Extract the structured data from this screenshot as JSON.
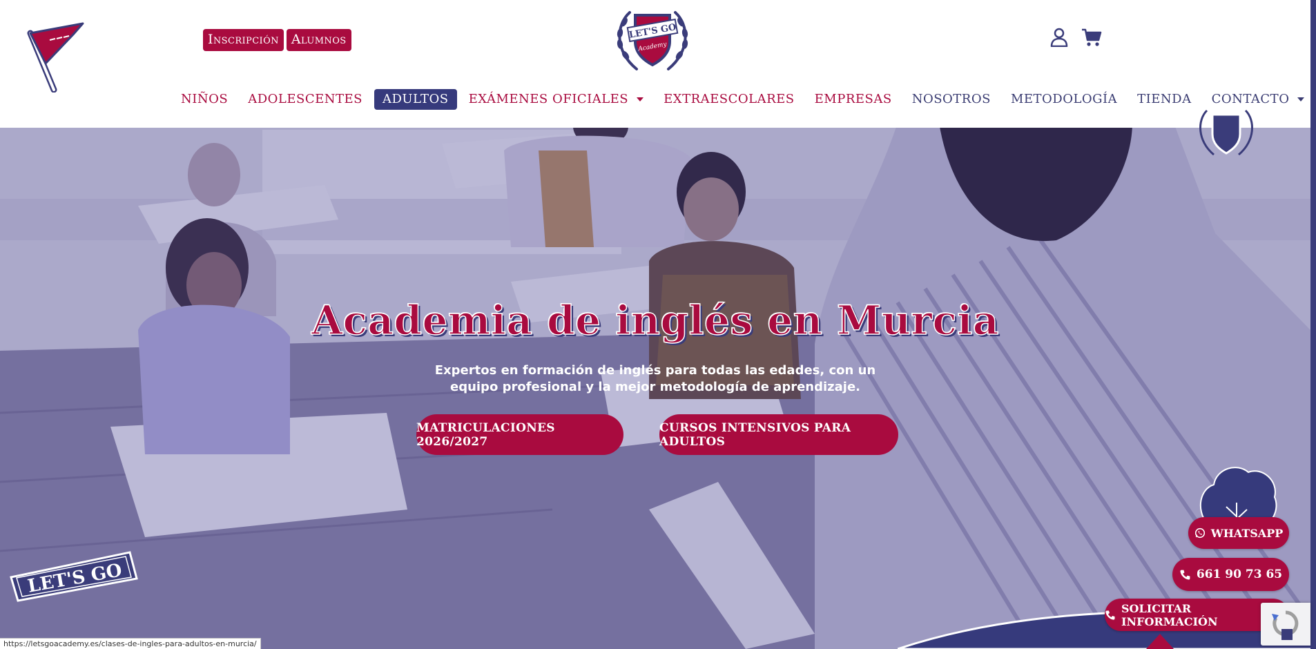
{
  "top_links": [
    {
      "label": "Inscripción"
    },
    {
      "label": "Alumnos"
    }
  ],
  "brand": {
    "line1": "LET'S GO",
    "line2": "Academy"
  },
  "nav": [
    {
      "label": "NIÑOS"
    },
    {
      "label": "ADOLESCENTES"
    },
    {
      "label": "ADULTOS"
    },
    {
      "label": "EXÁMENES OFICIALES"
    },
    {
      "label": "EXTRAESCOLARES"
    },
    {
      "label": "EMPRESAS"
    },
    {
      "label": "NOSOTROS"
    },
    {
      "label": "METODOLOGÍA"
    },
    {
      "label": "TIENDA"
    },
    {
      "label": "CONTACTO"
    }
  ],
  "hero": {
    "title": "Academia de inglés en Murcia",
    "subtitle_line1": "Expertos en formación de inglés para todas las edades, con un",
    "subtitle_line2": "equipo profesional y la mejor metodología de aprendizaje.",
    "cta_primary": "MATRICULACIONES 2026/2027",
    "cta_secondary": "CURSOS INTENSIVOS PARA ADULTOS"
  },
  "sticker": {
    "text": "LET'S GO"
  },
  "floating": {
    "whatsapp": "WHATSAPP",
    "phone": "661 90 73 65",
    "info": "SOLICITAR INFORMACIÓN"
  },
  "status_bar": {
    "url": "https://letsgoacademy.es/clases-de-ingles-para-adultos-en-murcia/"
  },
  "colors": {
    "brand_red": "#a90b3f",
    "brand_navy": "#363a7c",
    "white": "#ffffff"
  },
  "icons": [
    "pennant-flag-icon",
    "user-account-icon",
    "shopping-cart-icon",
    "whatsapp-icon",
    "phone-icon",
    "shield-laurel-icon",
    "chevron-down-icon"
  ]
}
